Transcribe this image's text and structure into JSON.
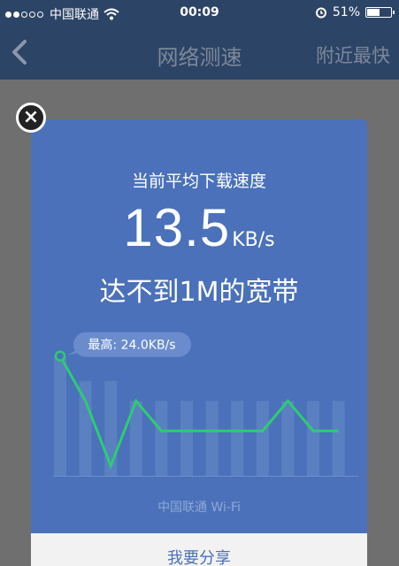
{
  "status_bar": {
    "carrier": "中国联通",
    "time": "00:09",
    "battery": "51%"
  },
  "nav": {
    "title": "网络测速",
    "right_label": "附近最快"
  },
  "card": {
    "label": "当前平均下载速度",
    "speed_value": "13.5",
    "speed_unit": "KB/s",
    "bandwidth_text": "达不到1M的宽带",
    "peak_label": "最高: 24.0KB/s",
    "network_info": "中国联通  Wi-Fi",
    "share_label": "我要分享"
  },
  "chart_data": {
    "type": "line",
    "series": [
      {
        "values": [
          24.0,
          15.0,
          2.0,
          15.0,
          9.0,
          9.0,
          9.0,
          9.0,
          9.0,
          15.0,
          9.0,
          9.0
        ]
      }
    ],
    "bars": [
      24.0,
      19.0,
      19.0,
      15.0,
      15.0,
      15.0,
      15.0,
      15.0,
      15.0,
      15.0,
      15.0,
      15.0
    ],
    "ylim": [
      0,
      28
    ]
  },
  "colors": {
    "card_bg": "#4a71b9",
    "line": "#2ecc71",
    "bar": "#5a80c2",
    "nav_bg": "#2c4466"
  }
}
